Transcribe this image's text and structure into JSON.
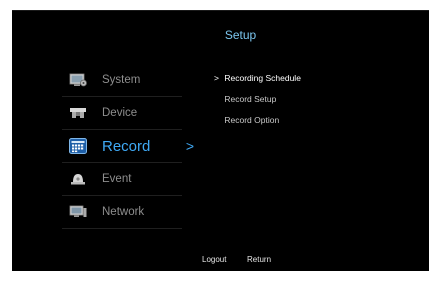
{
  "title": "Setup",
  "menu": {
    "items": [
      {
        "label": "System",
        "icon": "system-icon"
      },
      {
        "label": "Device",
        "icon": "device-icon"
      },
      {
        "label": "Record",
        "icon": "record-icon",
        "active": true
      },
      {
        "label": "Event",
        "icon": "event-icon"
      },
      {
        "label": "Network",
        "icon": "network-icon"
      }
    ],
    "arrow": ">"
  },
  "submenu": {
    "items": [
      {
        "label": "Recording Schedule",
        "prefix": ">"
      },
      {
        "label": "Record Setup"
      },
      {
        "label": "Record Option"
      }
    ]
  },
  "footer": {
    "logout": "Logout",
    "return": "Return"
  },
  "colors": {
    "accent": "#3fa9f5",
    "title": "#7cc7f0",
    "background": "#000000",
    "inactive": "#8e8e8e"
  }
}
